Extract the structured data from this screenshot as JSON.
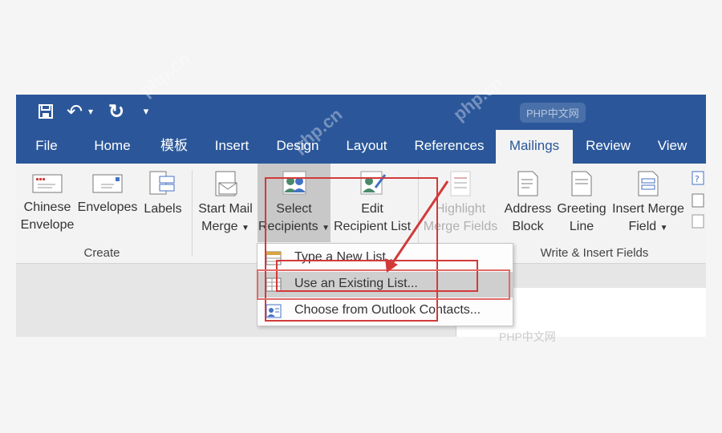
{
  "qat": {
    "undo_glyph": "↶",
    "redo_glyph": "↻",
    "customize_glyph": "▾"
  },
  "tabs": [
    "File",
    "Home",
    "模板",
    "Insert",
    "Design",
    "Layout",
    "References",
    "Mailings",
    "Review",
    "View"
  ],
  "ribbon": {
    "create": {
      "chinese_envelope": [
        "Chinese",
        "Envelope"
      ],
      "envelopes": "Envelopes",
      "labels": "Labels",
      "group_label": "Create"
    },
    "start": {
      "start_mail_merge": [
        "Start Mail",
        "Merge"
      ],
      "select_recipients": [
        "Select",
        "Recipients"
      ],
      "edit_recipient_list": [
        "Edit",
        "Recipient List"
      ]
    },
    "write": {
      "highlight_merge_fields": [
        "Highlight",
        "Merge Fields"
      ],
      "address_block": [
        "Address",
        "Block"
      ],
      "greeting_line": [
        "Greeting",
        "Line"
      ],
      "insert_merge_field": [
        "Insert Merge",
        "Field"
      ],
      "group_label": "Write & Insert Fields"
    }
  },
  "dropdown": {
    "items": [
      "Type a New List...",
      "Use an Existing List...",
      "Choose from Outlook Contacts..."
    ],
    "highlighted_index": 1
  },
  "watermarks": {
    "brand": "php.cn",
    "badge": "PHP中文网"
  },
  "colors": {
    "title_bar": "#2b579a",
    "annotation": "#d23a3a",
    "ribbon_bg": "#f3f3f3"
  }
}
